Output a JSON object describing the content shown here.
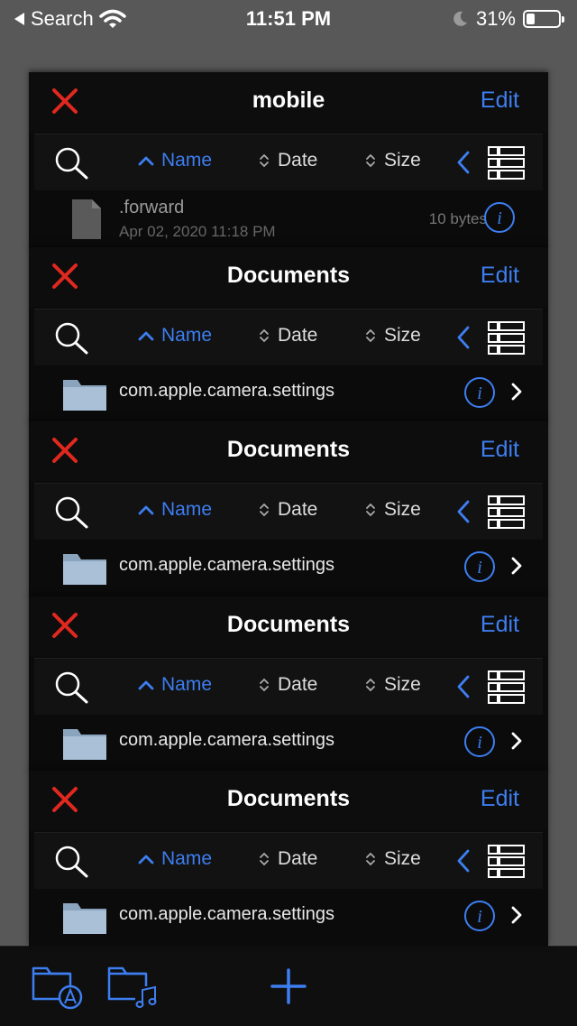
{
  "status_bar": {
    "back_label": "Search",
    "time": "11:51 PM",
    "battery": "31%"
  },
  "sort": {
    "name": "Name",
    "date": "Date",
    "size": "Size"
  },
  "cards": [
    {
      "title": "mobile",
      "edit": "Edit",
      "item": {
        "name": ".forward",
        "date": "Apr 02, 2020 11:18 PM",
        "size": "10 bytes",
        "kind": "file"
      }
    },
    {
      "title": "Documents",
      "edit": "Edit",
      "item": {
        "name": "com.apple.camera.settings",
        "kind": "folder"
      }
    },
    {
      "title": "Documents",
      "edit": "Edit",
      "item": {
        "name": "com.apple.camera.settings",
        "kind": "folder"
      }
    },
    {
      "title": "Documents",
      "edit": "Edit",
      "item": {
        "name": "com.apple.camera.settings",
        "kind": "folder"
      }
    },
    {
      "title": "Documents",
      "edit": "Edit",
      "item": {
        "name": "com.apple.camera.settings",
        "kind": "folder"
      }
    }
  ],
  "toolbar": {
    "buttons": [
      "apps-folder-icon",
      "music-folder-icon",
      "add-icon"
    ]
  },
  "colors": {
    "accent": "#3d7ef0",
    "close": "#e0281f",
    "background": "#585858"
  }
}
